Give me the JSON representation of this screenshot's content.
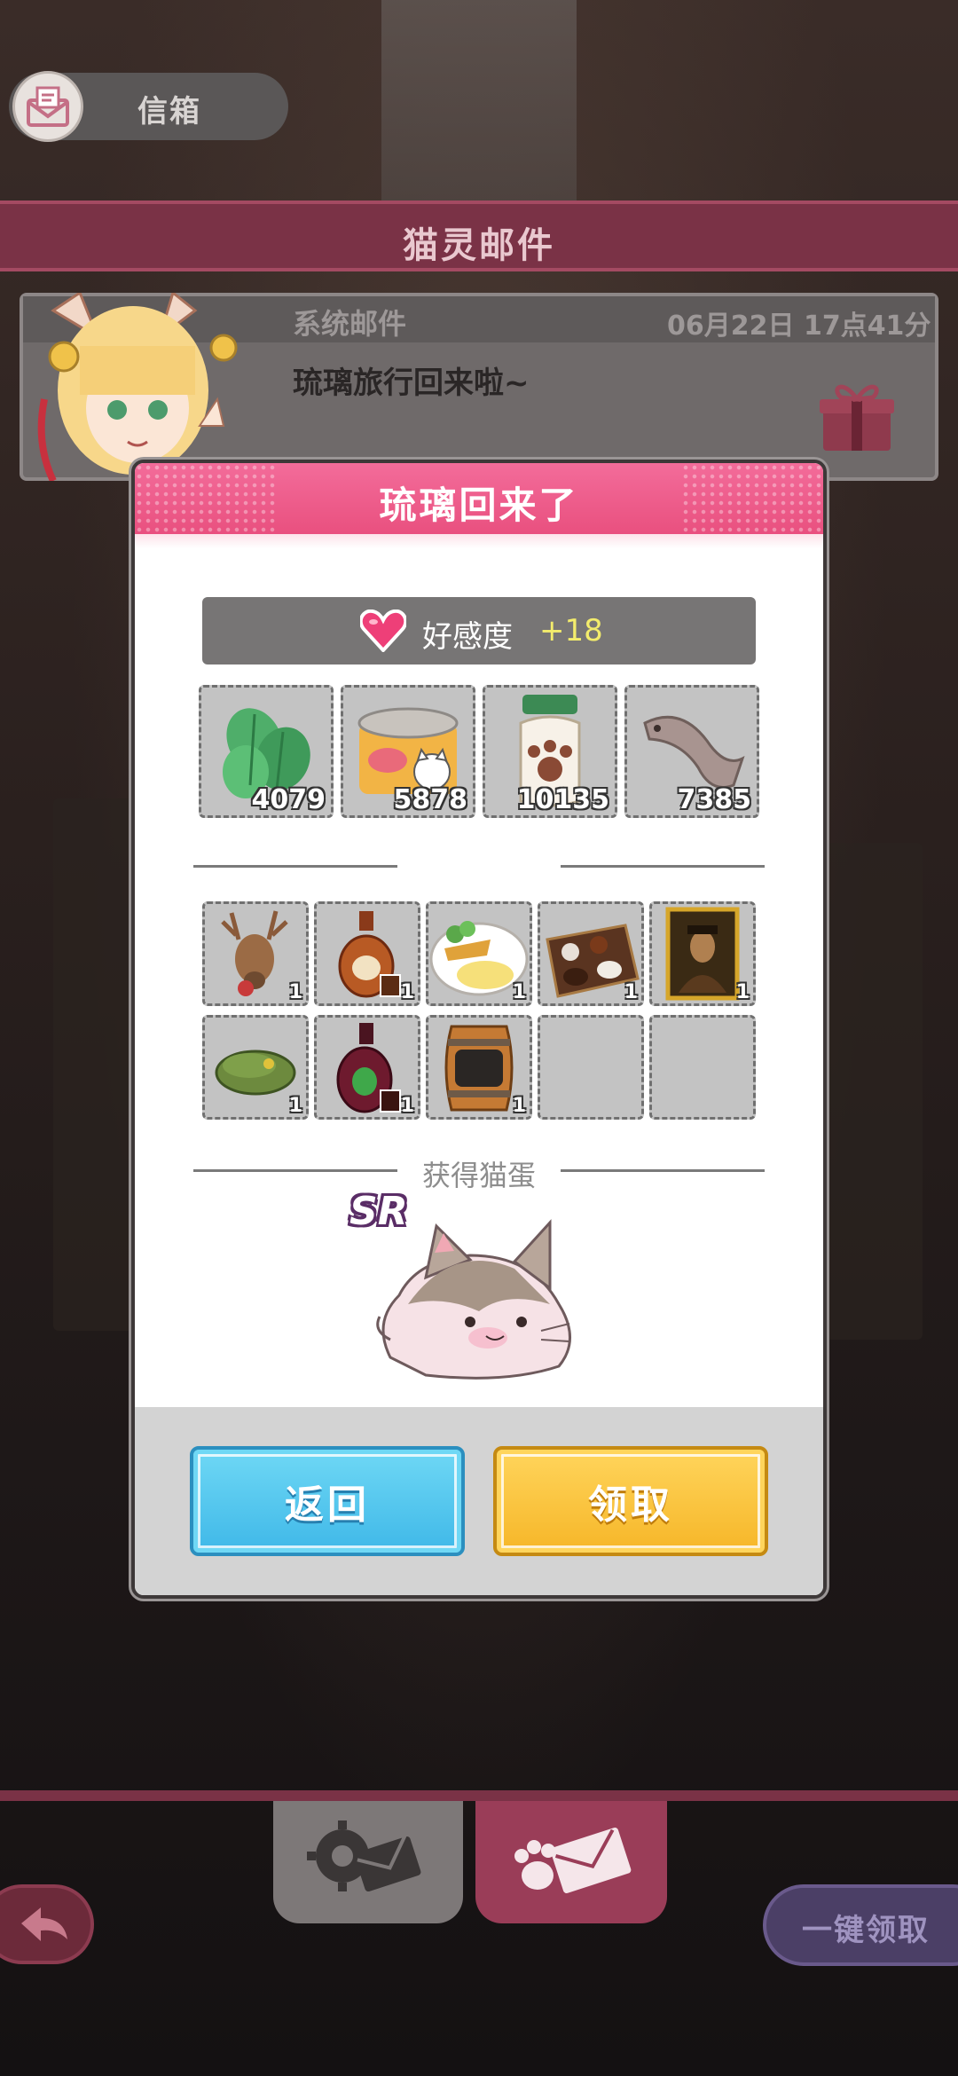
{
  "mailbox": {
    "label": "信箱",
    "icon": "mail-icon"
  },
  "header": {
    "title": "猫灵邮件"
  },
  "mail": {
    "sender": "系统邮件",
    "date": "06月22日 17点41分",
    "subject": "琉璃旅行回来啦~",
    "gift_icon": "gift-icon"
  },
  "dialog": {
    "title": "琉璃回来了",
    "favor": {
      "label": "好感度",
      "value": "+18",
      "icon": "heart-icon"
    },
    "currencies": [
      {
        "name": "mint-leaves",
        "count": "4079"
      },
      {
        "name": "canned-food",
        "count": "5878"
      },
      {
        "name": "paw-jar",
        "count": "10135"
      },
      {
        "name": "fish",
        "count": "7385"
      }
    ],
    "items_row1": [
      {
        "name": "deer-head",
        "count": "1"
      },
      {
        "name": "brandy-bottle",
        "count": "1"
      },
      {
        "name": "fish-and-chips",
        "count": "1"
      },
      {
        "name": "chocolate-box",
        "count": "1"
      },
      {
        "name": "portrait-painting",
        "count": "1"
      }
    ],
    "items_row2": [
      {
        "name": "green-beret",
        "count": "1"
      },
      {
        "name": "wine-bottle",
        "count": "1"
      },
      {
        "name": "wooden-barrel",
        "count": "1"
      },
      {
        "name": "empty",
        "count": ""
      },
      {
        "name": "empty",
        "count": ""
      }
    ],
    "egg_label": "获得猫蛋",
    "rarity": "SR",
    "back_label": "返回",
    "claim_label": "领取"
  },
  "footer": {
    "tab_system_icon": "gear-mail-icon",
    "tab_cat_icon": "paw-mail-icon",
    "back_icon": "back-arrow-icon",
    "claim_all_label": "一键领取"
  },
  "colors": {
    "accent_pink": "#e9507f",
    "header_bar": "#7a3246",
    "button_blue": "#3fb8e8",
    "button_yellow": "#f6b628",
    "favor_value": "#f3ec6c"
  }
}
